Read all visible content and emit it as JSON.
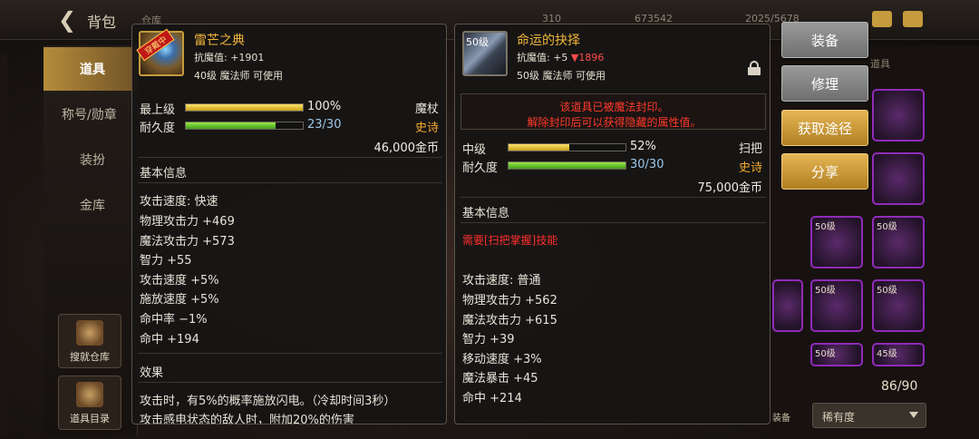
{
  "topbar": {
    "title": "背包",
    "faint_title": "仓库",
    "faint_values": [
      "310",
      "673542",
      "2025/5678"
    ]
  },
  "left_nav": {
    "items": [
      {
        "label": "道具",
        "active": true
      },
      {
        "label": "称号/勋章",
        "active": false
      },
      {
        "label": "装扮",
        "active": false
      },
      {
        "label": "金库",
        "active": false
      }
    ],
    "buttons": [
      {
        "label": "搜就仓库"
      },
      {
        "label": "道具目录"
      }
    ]
  },
  "actions": {
    "equip": "装备",
    "repair": "修理",
    "acquire": "获取途径",
    "share": "分享"
  },
  "inventory": {
    "tab": "道具",
    "count": "86/90",
    "sort": "稀有度",
    "equip_label": "装备",
    "slot_levels": [
      "50级",
      "50级",
      "50级",
      "50级",
      "50级",
      "45级"
    ]
  },
  "tooltip_left": {
    "ribbon": "穿戴中",
    "name": "雷芒之典",
    "resist": "抗魔值: +1901",
    "requirement": "40级 魔法师 可使用",
    "grade": "最上级",
    "grade_percent": "100%",
    "grade_value": 100,
    "item_type": "魔杖",
    "durability_label": "耐久度",
    "durability": "23/30",
    "durability_value": 0.7667,
    "rarity": "史诗",
    "price": "46,000金币",
    "section_basic": "基本信息",
    "stats": [
      "攻击速度: 快速",
      "物理攻击力 +469",
      "魔法攻击力 +573",
      "智力 +55",
      "攻击速度 +5%",
      "施放速度 +5%",
      "命中率 −1%",
      "命中 +194"
    ],
    "section_effect": "效果",
    "effect_lines": [
      "攻击时，有5%的概率施放闪电。（冷却时间3秒）",
      "攻击感电状态的敌人时，附加20%的伤害"
    ]
  },
  "tooltip_right": {
    "level_tag": "50级",
    "name": "命运的抉择",
    "resist_prefix": "抗魔值: +5",
    "resist_down": "▼1896",
    "requirement": "50级 魔法师 可使用",
    "seal_line1": "该道具已被魔法封印。",
    "seal_line2": "解除封印后可以获得隐藏的属性值。",
    "grade": "中级",
    "grade_percent": "52%",
    "grade_value": 52,
    "item_type": "扫把",
    "durability_label": "耐久度",
    "durability": "30/30",
    "durability_value": 1.0,
    "rarity": "史诗",
    "price": "75,000金币",
    "section_basic": "基本信息",
    "need_skill": "需要[扫把掌握]技能",
    "stats": [
      "攻击速度: 普通",
      "物理攻击力 +562",
      "魔法攻击力 +615",
      "智力 +39",
      "移动速度 +3%",
      "魔法暴击 +45",
      "命中 +214"
    ]
  },
  "colors": {
    "gold_name": "#f0b43c",
    "epic": "#f3a92b",
    "seal_red": "#ff3a2a",
    "gold_button": "#d9a640",
    "gray_button": "#8a8a8a"
  }
}
